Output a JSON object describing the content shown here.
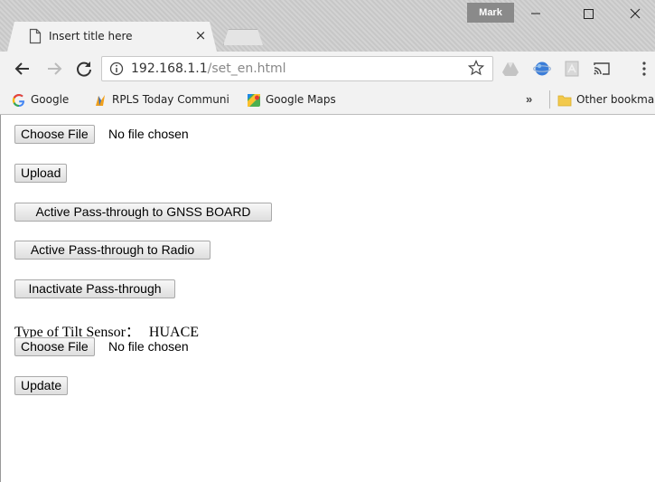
{
  "window": {
    "profile_name": "Mark"
  },
  "tab": {
    "title": "Insert title here",
    "close_glyph": "×"
  },
  "toolbar": {
    "url_host": "192.168.1.1",
    "url_path": "/set_en.html"
  },
  "bookmarks": {
    "items": [
      {
        "label": "Google",
        "icon": "google-icon"
      },
      {
        "label": "RPLS Today Communi",
        "icon": "rpls-icon"
      },
      {
        "label": "Google Maps",
        "icon": "maps-icon"
      }
    ],
    "overflow_label": "»",
    "other_label": "Other bookmarks"
  },
  "page": {
    "file_input_1": {
      "button_label": "Choose File",
      "status": "No file chosen"
    },
    "upload_label": "Upload",
    "pass_gnss_label": "Active Pass-through to GNSS BOARD",
    "pass_radio_label": "Active Pass-through to Radio",
    "inactivate_label": "Inactivate Pass-through",
    "tilt": {
      "label": "Type of Tilt Sensor：",
      "value": "HUACE"
    },
    "file_input_2": {
      "button_label": "Choose File",
      "status": "No file chosen"
    },
    "update_label": "Update"
  },
  "colors": {
    "titlebar": "#cfcfcf",
    "toolbar": "#f2f2f2",
    "profile_badge": "#8a8a8a"
  }
}
